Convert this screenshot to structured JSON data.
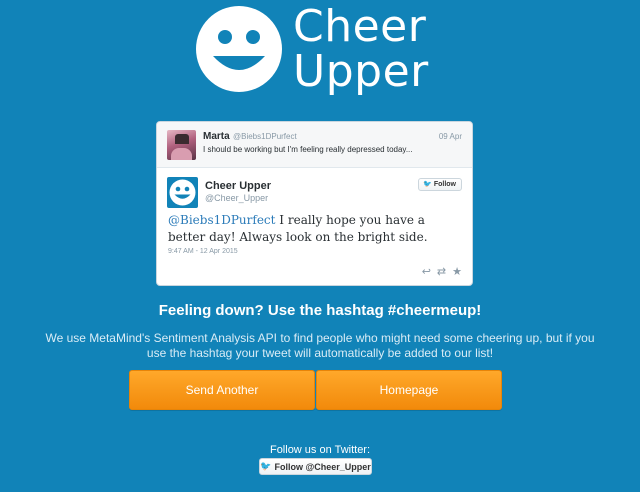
{
  "logo": {
    "line1": "Cheer",
    "line2": "Upper"
  },
  "tweet_card": {
    "reply": {
      "name": "Marta",
      "handle": "@Biebs1DPurfect",
      "date": "09 Apr",
      "text": "I should be working but I'm feeling really depressed today..."
    },
    "main": {
      "name": "Cheer Upper",
      "handle": "@Cheer_Upper",
      "follow_label": "Follow",
      "mention": "@Biebs1DPurfect",
      "text": " I really hope you have a better day! Always look on the bright side.",
      "timestamp": "9:47 AM - 12 Apr 2015"
    },
    "actions": [
      "reply-icon",
      "retweet-icon",
      "favorite-icon"
    ]
  },
  "headline": "Feeling down? Use the hashtag #cheermeup!",
  "description": "We use MetaMind's Sentiment Analysis API to find people who might need some cheering up, but if you use the hashtag your tweet will automatically be added to our list!",
  "buttons": {
    "send_another": "Send Another",
    "homepage": "Homepage"
  },
  "footer": {
    "follow_text": "Follow us on Twitter:",
    "follow_button": "Follow @Cheer_Upper"
  },
  "colors": {
    "background": "#1183b8",
    "button": "#f7941d",
    "link": "#2b7bb9"
  }
}
